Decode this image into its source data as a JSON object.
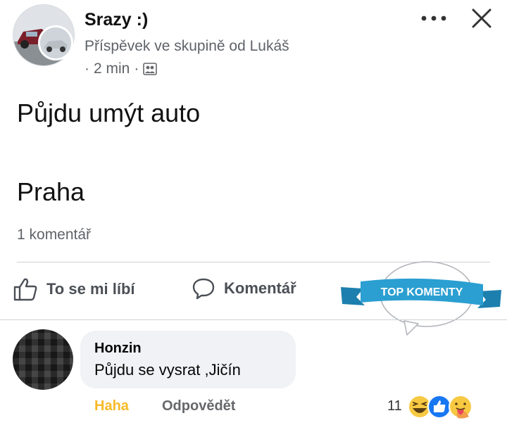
{
  "post": {
    "group_name": "Srazy :)",
    "meta": "Příspěvek ve skupině od Lukáš",
    "time_dot": "·",
    "time": "2 min",
    "time_dot_2": "·",
    "lines": [
      "Půjdu umýt auto",
      "Praha"
    ],
    "comment_count": "1 komentář"
  },
  "actions": {
    "like_label": "To se mi líbí",
    "comment_label": "Komentář"
  },
  "banner": {
    "text": "TOP KOMENTY",
    "color": "#2b9fd1"
  },
  "comment": {
    "author": "Honzin",
    "text": "Půjdu se vysrat ,Jičín",
    "reaction_label": "Haha",
    "reply_label": "Odpovědět",
    "reaction_count": "11",
    "reactions": [
      "haha-icon",
      "like-icon",
      "care-icon"
    ]
  },
  "icons": {
    "more": "more-options-icon",
    "close": "close-icon",
    "group_privacy": "group-members-icon",
    "like": "thumbs-up-icon",
    "comment": "comment-bubble-icon"
  },
  "colors": {
    "haha_accent": "#f7b928",
    "muted_text": "#65676b",
    "bubble_bg": "#f0f2f5"
  }
}
